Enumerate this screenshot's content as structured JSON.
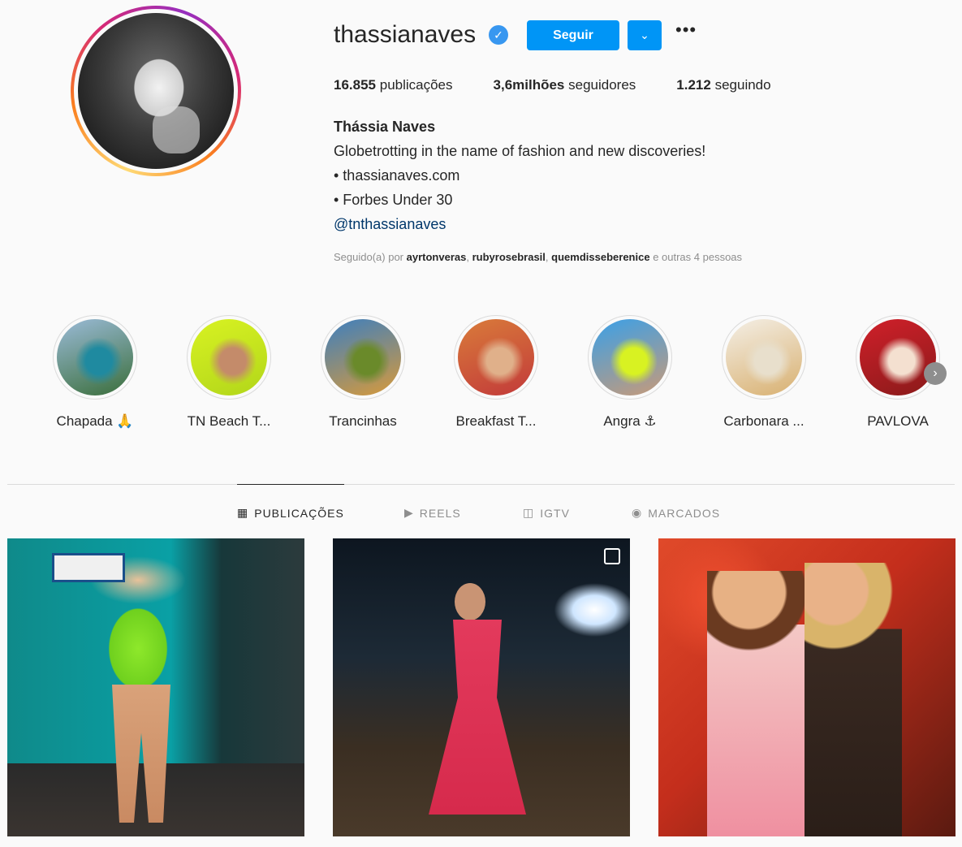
{
  "profile": {
    "username": "thassianaves",
    "verified_mark": "✓",
    "follow_label": "Seguir",
    "dropdown_icon": "⌄",
    "more_icon": "•••",
    "stats": {
      "posts_count": "16.855",
      "posts_label": "publicações",
      "followers_count": "3,6milhões",
      "followers_label": "seguidores",
      "following_count": "1.212",
      "following_label": "seguindo"
    },
    "full_name": "Thássia Naves",
    "bio": {
      "line1": "Globetrotting in the name of fashion and new discoveries!",
      "line2": "• thassianaves.com",
      "line3": "• Forbes Under 30",
      "line4": "@tnthassianaves"
    },
    "followed_by": {
      "prefix": "Seguido(a) por",
      "user1": "ayrtonveras",
      "user2": "rubyrosebrasil",
      "user3": "quemdisseberenice",
      "sep": ",",
      "suffix": "e outras 4 pessoas"
    }
  },
  "highlights": [
    {
      "label": "Chapada 🙏",
      "colors": [
        "#9bbbd8",
        "#3a6e3a",
        "#1f8aa0"
      ]
    },
    {
      "label": "TN Beach T...",
      "colors": [
        "#d8f222",
        "#b2d61a",
        "#c48b6a"
      ]
    },
    {
      "label": "Trancinhas",
      "colors": [
        "#3d7fbf",
        "#d89a3a",
        "#6a8a2a"
      ]
    },
    {
      "label": "Breakfast T...",
      "colors": [
        "#d97b3a",
        "#c23a3a",
        "#e0b08a"
      ]
    },
    {
      "label": "Angra ⚓",
      "colors": [
        "#3aa0e8",
        "#c89a78",
        "#d8f222"
      ]
    },
    {
      "label": "Carbonara ...",
      "colors": [
        "#f4efe6",
        "#d8b070",
        "#e8dfcc"
      ]
    },
    {
      "label": "PAVLOVA",
      "colors": [
        "#d0202a",
        "#8a1a1a",
        "#f4e0d0"
      ]
    }
  ],
  "next_icon": "›",
  "tabs": [
    {
      "label": "PUBLICAÇÕES",
      "icon": "▦"
    },
    {
      "label": "REELS",
      "icon": "▶"
    },
    {
      "label": "IGTV",
      "icon": "◫"
    },
    {
      "label": "MARCADOS",
      "icon": "◉"
    }
  ]
}
